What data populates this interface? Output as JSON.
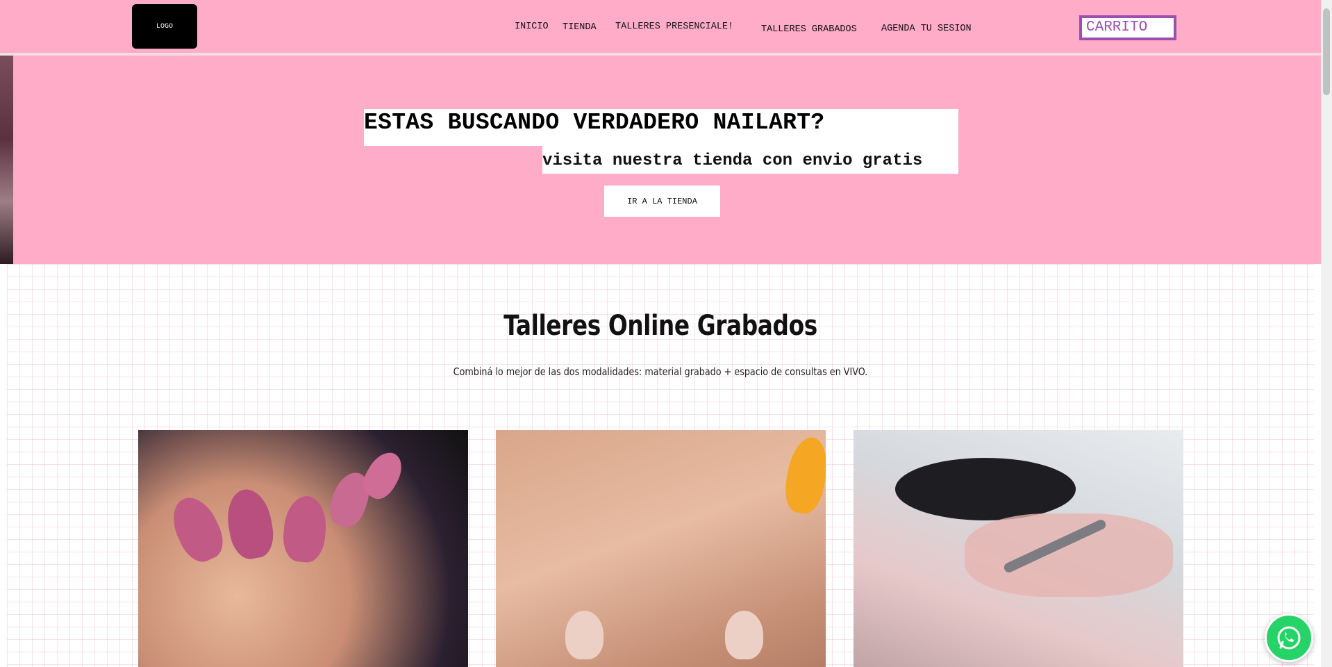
{
  "header": {
    "logo_text": "LOGO",
    "nav": [
      "INICIO",
      "TIENDA",
      "TALLERES PRESENCIALE!",
      "TALLERES GRABADOS",
      "AGENDA TU SESION"
    ],
    "cart_label": "CARRITO"
  },
  "hero": {
    "title": "ESTAS BUSCANDO VERDADERO NAILART?",
    "subtitle": "visita nuestra tienda con envio gratis",
    "button_label": "IR A LA TIENDA"
  },
  "section": {
    "title": "Talleres Online Grabados",
    "subtitle": "Combiná lo mejor de las dos modalidades: material grabado + espacio de consultas en VIVO."
  },
  "colors": {
    "header_bg": "#ffacc8",
    "cart_accent": "#9b4fb0",
    "whatsapp": "#25d366"
  },
  "icons": {
    "whatsapp": "whatsapp-icon"
  }
}
